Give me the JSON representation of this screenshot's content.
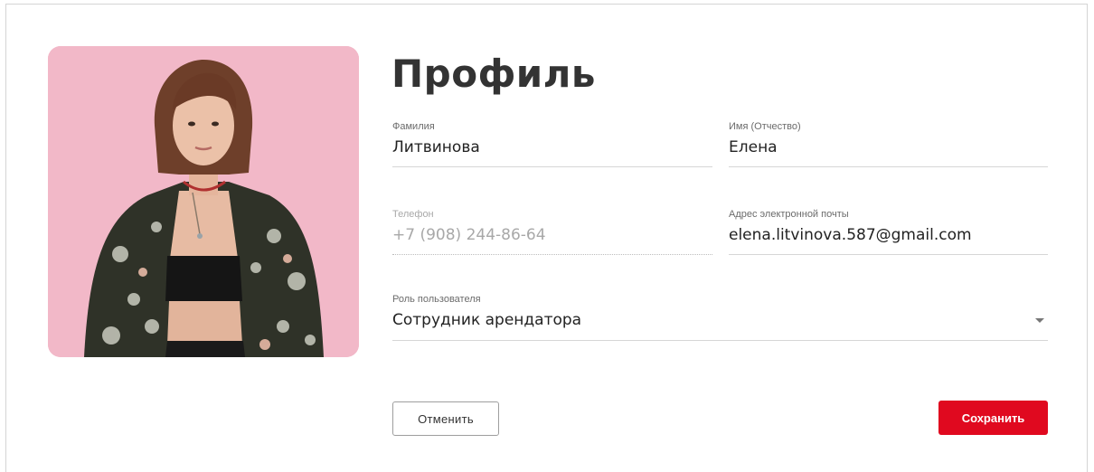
{
  "profile": {
    "title": "Профиль",
    "photo_alt": "Фото профиля"
  },
  "fields": {
    "last_name": {
      "label": "Фамилия",
      "value": "Литвинова"
    },
    "first_name": {
      "label": "Имя (Отчество)",
      "value": "Елена"
    },
    "phone": {
      "label": "Телефон",
      "value": "+7 (908) 244-86-64",
      "disabled": true
    },
    "email": {
      "label": "Адрес электронной почты",
      "value": "elena.litvinova.587@gmail.com"
    },
    "role": {
      "label": "Роль пользователя",
      "value": "Сотрудник арендатора",
      "icon": "chevron-down-icon"
    }
  },
  "actions": {
    "cancel_label": "Отменить",
    "save_label": "Сохранить"
  },
  "colors": {
    "accent": "#e0091f",
    "photo_background": "#f0b6c6",
    "title": "#333333"
  }
}
